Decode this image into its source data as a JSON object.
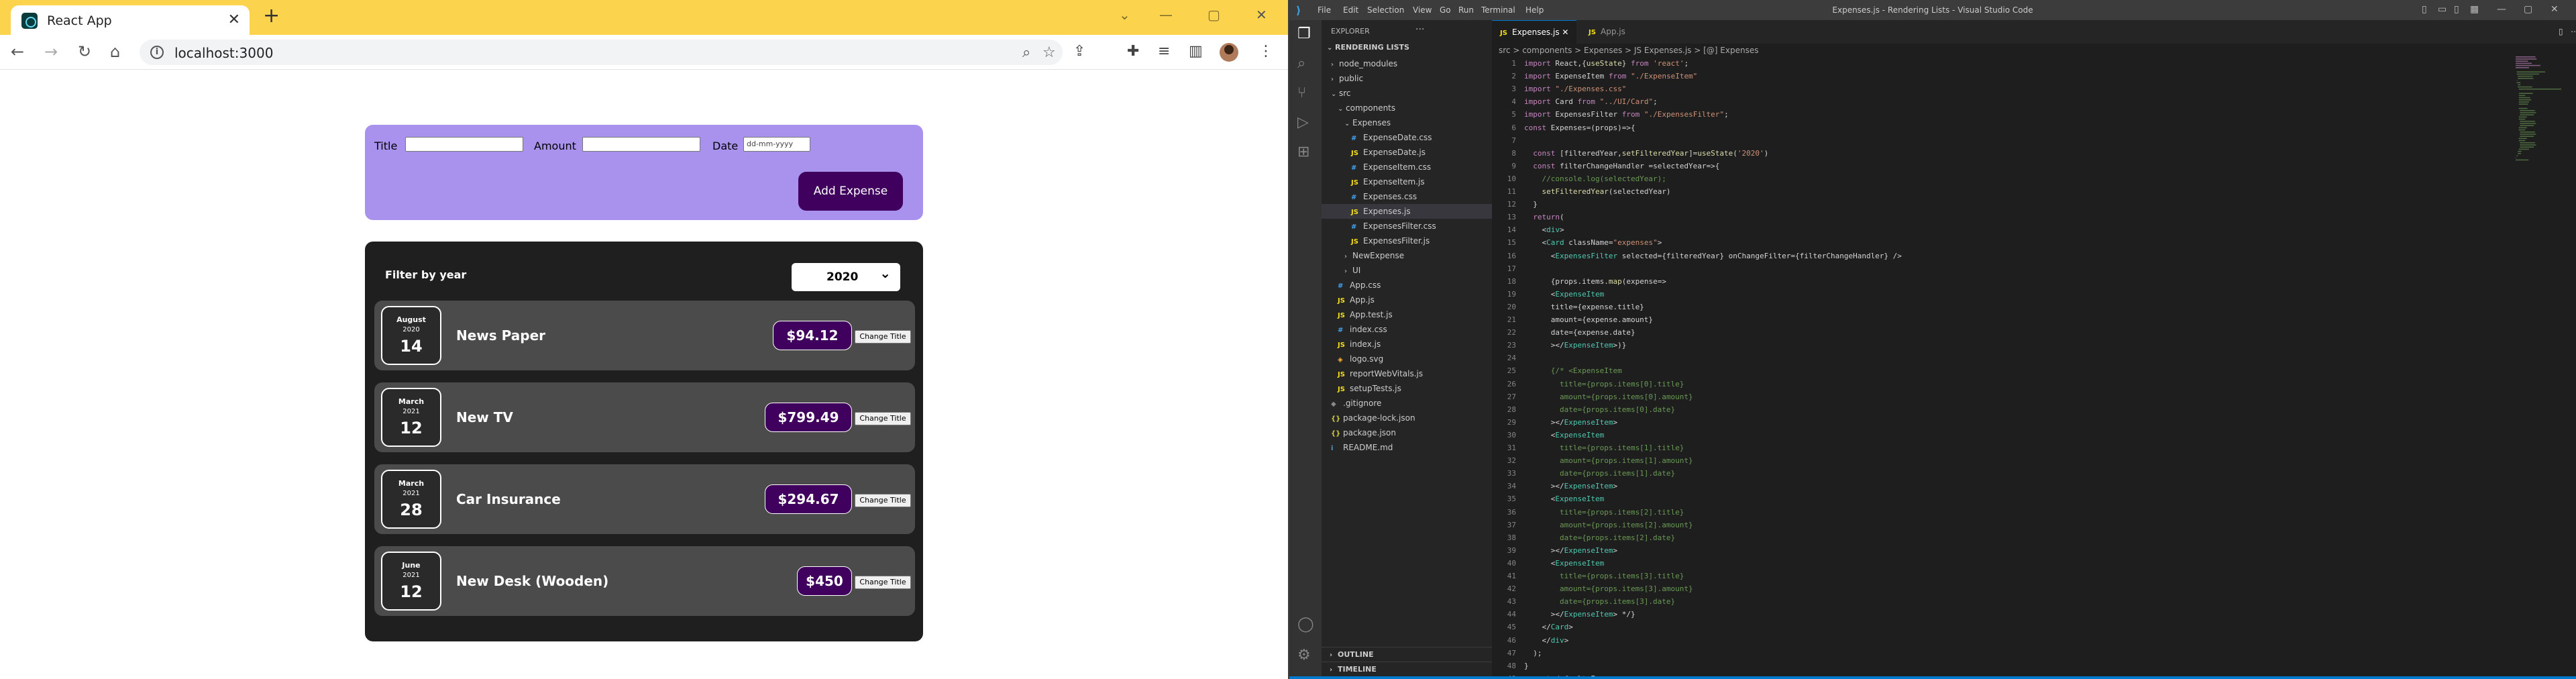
{
  "browser": {
    "tab_title": "React App",
    "url": "localhost:3000"
  },
  "app": {
    "form": {
      "title_label": "Title",
      "amount_label": "Amount",
      "date_label": "Date",
      "date_placeholder": "dd-mm-yyyy",
      "add_button": "Add Expense"
    },
    "filter": {
      "label": "Filter by year",
      "selected": "2020"
    },
    "expenses": [
      {
        "month": "August",
        "year": "2020",
        "day": "14",
        "title": "News Paper",
        "amount": "$94.12"
      },
      {
        "month": "March",
        "year": "2021",
        "day": "12",
        "title": "New TV",
        "amount": "$799.49"
      },
      {
        "month": "March",
        "year": "2021",
        "day": "28",
        "title": "Car Insurance",
        "amount": "$294.67"
      },
      {
        "month": "June",
        "year": "2021",
        "day": "12",
        "title": "New Desk (Wooden)",
        "amount": "$450"
      }
    ],
    "change_title_label": "Change Title"
  },
  "vscode": {
    "window_title": "Expenses.js - Rendering Lists - Visual Studio Code",
    "menu": [
      "File",
      "Edit",
      "Selection",
      "View",
      "Go",
      "Run",
      "Terminal",
      "Help"
    ],
    "explorer_header": "EXPLORER",
    "project": "RENDERING LISTS",
    "tabs": [
      {
        "label": "Expenses.js",
        "active": true
      },
      {
        "label": "App.js",
        "active": false
      }
    ],
    "breadcrumb": "src > components > Expenses > JS Expenses.js > [@] Expenses",
    "tree": [
      {
        "label": "node_modules",
        "depth": 1,
        "kind": "folder",
        "open": false
      },
      {
        "label": "public",
        "depth": 1,
        "kind": "folder",
        "open": false
      },
      {
        "label": "src",
        "depth": 1,
        "kind": "folder",
        "open": true
      },
      {
        "label": "components",
        "depth": 2,
        "kind": "folder",
        "open": true
      },
      {
        "label": "Expenses",
        "depth": 3,
        "kind": "folder",
        "open": true
      },
      {
        "label": "ExpenseDate.css",
        "depth": 4,
        "kind": "css"
      },
      {
        "label": "ExpenseDate.js",
        "depth": 4,
        "kind": "js"
      },
      {
        "label": "ExpenseItem.css",
        "depth": 4,
        "kind": "css"
      },
      {
        "label": "ExpenseItem.js",
        "depth": 4,
        "kind": "js"
      },
      {
        "label": "Expenses.css",
        "depth": 4,
        "kind": "css"
      },
      {
        "label": "Expenses.js",
        "depth": 4,
        "kind": "js",
        "selected": true
      },
      {
        "label": "ExpensesFilter.css",
        "depth": 4,
        "kind": "css"
      },
      {
        "label": "ExpensesFilter.js",
        "depth": 4,
        "kind": "js"
      },
      {
        "label": "NewExpense",
        "depth": 3,
        "kind": "folder",
        "open": false
      },
      {
        "label": "UI",
        "depth": 3,
        "kind": "folder",
        "open": false
      },
      {
        "label": "App.css",
        "depth": 2,
        "kind": "css"
      },
      {
        "label": "App.js",
        "depth": 2,
        "kind": "js"
      },
      {
        "label": "App.test.js",
        "depth": 2,
        "kind": "js"
      },
      {
        "label": "index.css",
        "depth": 2,
        "kind": "css"
      },
      {
        "label": "index.js",
        "depth": 2,
        "kind": "js"
      },
      {
        "label": "logo.svg",
        "depth": 2,
        "kind": "svg"
      },
      {
        "label": "reportWebVitals.js",
        "depth": 2,
        "kind": "js"
      },
      {
        "label": "setupTests.js",
        "depth": 2,
        "kind": "js"
      },
      {
        "label": ".gitignore",
        "depth": 1,
        "kind": "git"
      },
      {
        "label": "package-lock.json",
        "depth": 1,
        "kind": "json"
      },
      {
        "label": "package.json",
        "depth": 1,
        "kind": "json"
      },
      {
        "label": "README.md",
        "depth": 1,
        "kind": "md"
      }
    ],
    "outline_label": "OUTLINE",
    "timeline_label": "TIMELINE",
    "code": [
      "import React,{useState} from 'react';",
      "import ExpenseItem from \"./ExpenseItem\"",
      "import \"./Expenses.css\"",
      "import Card from \"../UI/Card\";",
      "import ExpensesFilter from \"./ExpensesFilter\";",
      "const Expenses=(props)=>{",
      "",
      "  const [filteredYear,setFilteredYear]=useState('2020')",
      "  const filterChangeHandler =selectedYear=>{",
      "    //console.log(selectedYear);",
      "    setFilteredYear(selectedYear)",
      "  }",
      "  return(",
      "    <div>",
      "    <Card className=\"expenses\">",
      "      <ExpensesFilter selected={filteredYear} onChangeFilter={filterChangeHandler} />",
      "",
      "      {props.items.map(expense=>",
      "      <ExpenseItem",
      "      title={expense.title}",
      "      amount={expense.amount}",
      "      date={expense.date}",
      "      ></ExpenseItem>)}",
      "",
      "      {/* <ExpenseItem",
      "        title={props.items[0].title}",
      "        amount={props.items[0].amount}",
      "        date={props.items[0].date}",
      "      ></ExpenseItem>",
      "      <ExpenseItem",
      "        title={props.items[1].title}",
      "        amount={props.items[1].amount}",
      "        date={props.items[1].date}",
      "      ></ExpenseItem>",
      "      <ExpenseItem",
      "        title={props.items[2].title}",
      "        amount={props.items[2].amount}",
      "        date={props.items[2].date}",
      "      ></ExpenseItem>",
      "      <ExpenseItem",
      "        title={props.items[3].title}",
      "        amount={props.items[3].amount}",
      "        date={props.items[3].date}",
      "      ></ExpenseItem> */}",
      "    </Card>",
      "    </div>",
      "  );",
      "}",
      "export default Expenses;"
    ],
    "colors": {
      "accent": "#007acc",
      "chrome_tab_strip": "#fcd34d",
      "form_bg": "#a892ee",
      "button_purple": "#40005d"
    }
  }
}
